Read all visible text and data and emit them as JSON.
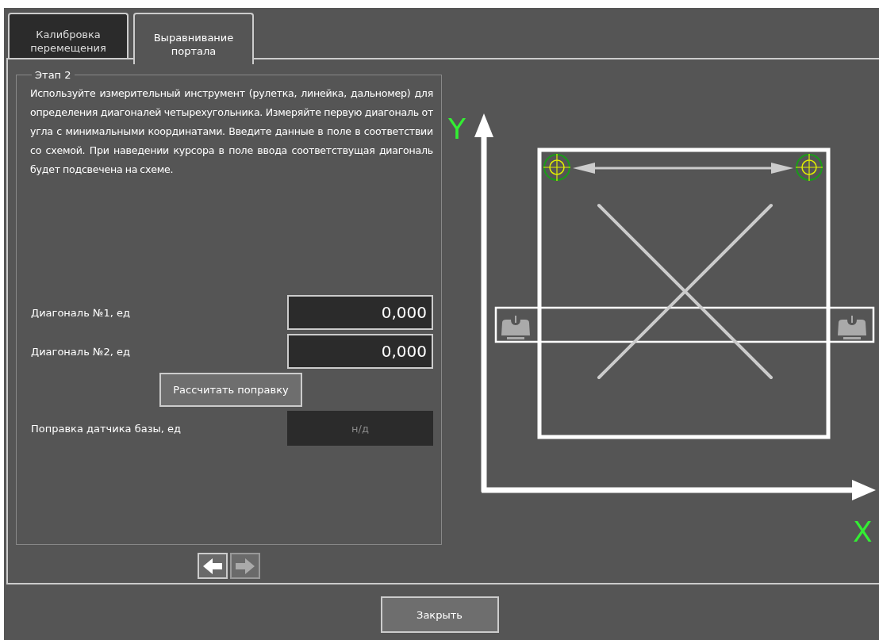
{
  "tabs": [
    {
      "label": "Калибровка перемещения",
      "selected": false
    },
    {
      "label": "Выравнивание портала",
      "selected": true
    }
  ],
  "stage": {
    "legend": "Этап 2",
    "instructions": "Используйте измерительный инструмент (рулетка, линейка, дальномер) для определения диагоналей четырехугольника. Измеряйте первую диагональ от угла с минимальными координатами. Введите данные в поле в соответствии со схемой. При наведении курсора в поле ввода соответствущая диагональ будет подсвечена на схеме.",
    "fields": [
      {
        "label": "Диагональ №1, ед",
        "value": "0,000",
        "disabled": false
      },
      {
        "label": "Диагональ №2, ед",
        "value": "0,000",
        "disabled": false
      }
    ],
    "calculate_button": "Рассчитать поправку",
    "correction": {
      "label": "Поправка датчика базы, ед",
      "value": "н/д",
      "disabled": true
    }
  },
  "navigation": [
    {
      "kind": "back",
      "disabled": false
    },
    {
      "kind": "forward",
      "disabled": true
    }
  ],
  "diagram": {
    "y_axis_label": "Y",
    "x_axis_label": "X"
  },
  "close_button": "Закрыть"
}
